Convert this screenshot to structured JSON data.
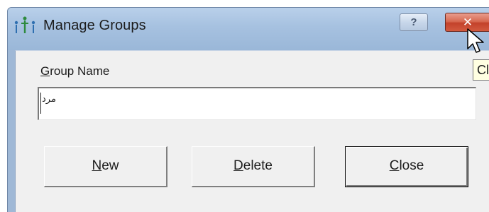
{
  "window": {
    "title": "Manage Groups",
    "help_glyph": "?",
    "close_glyph": "✕"
  },
  "tooltip": {
    "text": "Cl"
  },
  "form": {
    "group_name_label_mnemonic": "G",
    "group_name_label_rest": "roup Name",
    "group_name_value": "مرد"
  },
  "buttons": {
    "new_mnemonic": "N",
    "new_rest": "ew",
    "delete_mnemonic": "D",
    "delete_rest": "elete",
    "close_mnemonic": "C",
    "close_rest": "lose"
  },
  "icons": {
    "app": "manage-groups-icon",
    "cursor": "mouse-pointer-icon"
  },
  "colors": {
    "titlebar": "#a6c1e0",
    "close_button": "#c3422b",
    "client": "#f0f0f0",
    "tooltip": "#ffffe1"
  }
}
